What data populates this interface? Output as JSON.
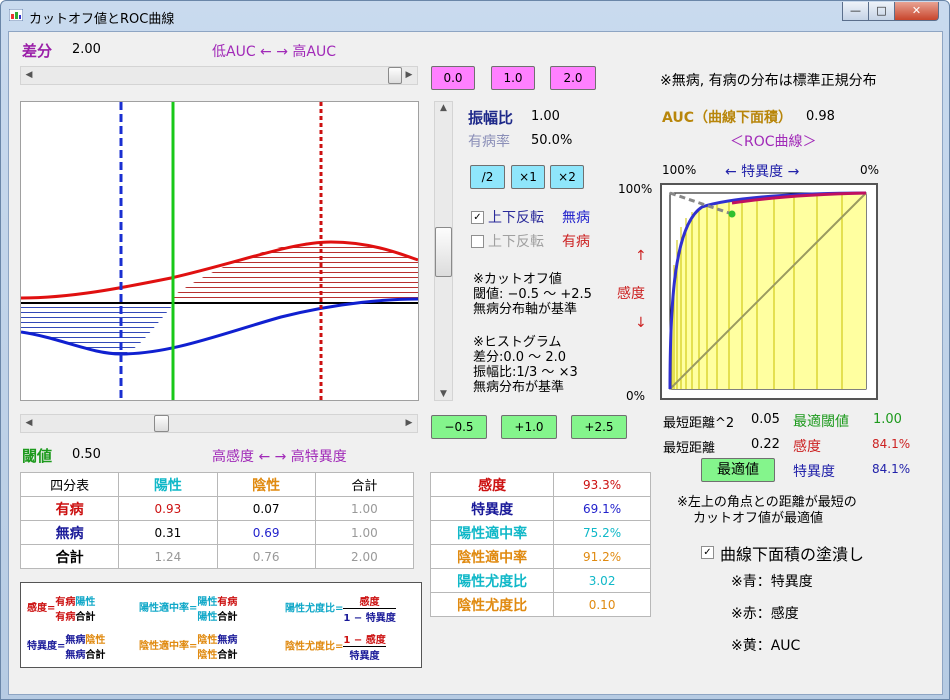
{
  "window": {
    "title": "カットオフ値とROC曲線",
    "min": "—",
    "max": "□",
    "close": "✕"
  },
  "diff": {
    "label": "差分",
    "value": "2.00",
    "scale": "低AUC ← → 高AUC"
  },
  "diff_buttons": [
    "0.0",
    "1.0",
    "2.0"
  ],
  "note_dist": "※無病, 有病の分布は標準正規分布",
  "amp": {
    "label": "振幅比",
    "value": "1.00"
  },
  "prev": {
    "label": "有病率",
    "value": "50.0%"
  },
  "amp_buttons": [
    "/2",
    "×1",
    "×2"
  ],
  "flip1": {
    "label": "上下反転",
    "name": "無病",
    "checked": true
  },
  "flip2": {
    "label": "上下反転",
    "name": "有病",
    "checked": false
  },
  "info_cutoff": [
    "※カットオフ値",
    "閾値: −0.5 〜 +2.5",
    "無病分布軸が基準"
  ],
  "info_hist": [
    "※ヒストグラム",
    "差分:0.0 〜 2.0",
    "振幅比:1/3 〜 ×3",
    "無病分布が基準"
  ],
  "auc": {
    "label": "AUC（曲線下面積）",
    "value": "0.98",
    "roc_title": "＜ROC曲線＞"
  },
  "roc": {
    "spec_100": "100%",
    "spec_label": "←  特異度  →",
    "spec_0": "0%",
    "sens_100": "100%",
    "sens_0": "0%",
    "sens_up": "↑",
    "sens_label": "感度",
    "sens_down": "↓"
  },
  "min_dist": {
    "sq_label": "最短距離^2",
    "sq_value": "0.05",
    "opt_label": "最適閾値",
    "opt_value": "1.00",
    "dist_label": "最短距離",
    "dist_value": "0.22",
    "sens_label": "感度",
    "sens_value": "84.1%",
    "spec_label": "特異度",
    "spec_value": "84.1%",
    "btn": "最適値"
  },
  "threshold": {
    "label": "閾値",
    "value": "0.50",
    "scale": "高感度 ← → 高特異度"
  },
  "th_buttons": [
    "−0.5",
    "+1.0",
    "+2.5"
  ],
  "table4": {
    "header": [
      "四分表",
      "陽性",
      "陰性",
      "合計"
    ],
    "rows": [
      [
        "有病",
        "0.93",
        "0.07",
        "1.00"
      ],
      [
        "無病",
        "0.31",
        "0.69",
        "1.00"
      ],
      [
        "合計",
        "1.24",
        "0.76",
        "2.00"
      ]
    ]
  },
  "metrics": [
    [
      "感度",
      "93.3%"
    ],
    [
      "特異度",
      "69.1%"
    ],
    [
      "陽性適中率",
      "75.2%"
    ],
    [
      "陰性適中率",
      "91.2%"
    ],
    [
      "陽性尤度比",
      "3.02"
    ],
    [
      "陰性尤度比",
      "0.10"
    ]
  ],
  "formulas": {
    "sens": {
      "name": "感度",
      "num_a": "有病",
      "num_b": "陽性",
      "den_a": "有病",
      "den_b": "合計"
    },
    "ppv": {
      "name": "陽性適中率",
      "num_a": "陽性",
      "num_b": "有病",
      "den_a": "陽性",
      "den_b": "合計"
    },
    "plr": {
      "name": "陽性尤度比",
      "num": "感度",
      "den": "1 − 特異度"
    },
    "spec": {
      "name": "特異度",
      "num_a": "無病",
      "num_b": "陰性",
      "den_a": "無病",
      "den_b": "合計"
    },
    "npv": {
      "name": "陰性適中率",
      "num_a": "陰性",
      "num_b": "無病",
      "den_a": "陰性",
      "den_b": "合計"
    },
    "nlr": {
      "name": "陰性尤度比",
      "num": "1 − 感度",
      "den": "特異度"
    }
  },
  "note_opt": [
    "※左上の角点との距離が最短の",
    "カットオフ値が最適値"
  ],
  "fill_chk": {
    "label": "曲線下面積の塗潰し",
    "checked": true
  },
  "legend": [
    "※青：特異度",
    "※赤：感度",
    "※黄：AUC"
  ]
}
